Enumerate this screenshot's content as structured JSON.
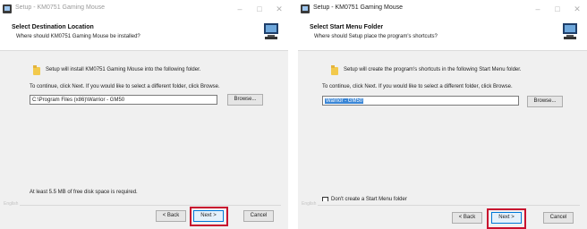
{
  "left_window": {
    "title": "Setup - KM0751 Gaming Mouse",
    "header_title": "Select Destination Location",
    "header_subtitle": "Where should KM0751 Gaming Mouse be installed?",
    "info": "Setup will install KM0751 Gaming Mouse into the following folder.",
    "hint": "To continue, click Next. If you would like to select a different folder, click Browse.",
    "path_value": "C:\\Program Files (x86)\\Warrior - GM50",
    "browse_label": "Browse...",
    "disk_space": "At least 5.5 MB of free disk space is required.",
    "language": "English",
    "back_label": "< Back",
    "next_label": "Next >",
    "cancel_label": "Cancel"
  },
  "right_window": {
    "title": "Setup - KM0751 Gaming Mouse",
    "header_title": "Select Start Menu Folder",
    "header_subtitle": "Where should Setup place the program's shortcuts?",
    "info": "Setup will create the program's shortcuts in the following Start Menu folder.",
    "hint": "To continue, click Next. If you would like to select a different folder, click Browse.",
    "folder_value": "Warrior - GM50",
    "browse_label": "Browse...",
    "checkbox_label": "Don't create a Start Menu folder",
    "checkbox_checked": false,
    "language": "English",
    "back_label": "< Back",
    "next_label": "Next >",
    "cancel_label": "Cancel"
  },
  "highlight_color": "#c8102e"
}
